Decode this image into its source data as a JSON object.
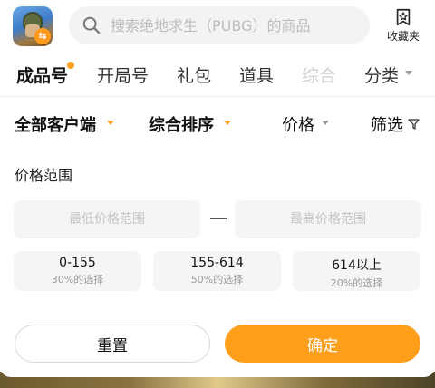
{
  "header": {
    "app_badge": "⇆",
    "search_placeholder": "搜索绝地求生（PUBG）的商品",
    "favorites_label": "收藏夹"
  },
  "tabs": [
    {
      "label": "成品号",
      "active": true
    },
    {
      "label": "开局号",
      "active": false
    },
    {
      "label": "礼包",
      "active": false
    },
    {
      "label": "道具",
      "active": false
    },
    {
      "label": "综合",
      "active": false
    },
    {
      "label": "分类",
      "active": false
    }
  ],
  "filters": {
    "client": "全部客户端",
    "sort": "综合排序",
    "price": "价格",
    "screen": "筛选"
  },
  "price_range": {
    "title": "价格范围",
    "min_placeholder": "最低价格范围",
    "max_placeholder": "最高价格范围",
    "options": [
      {
        "range": "0-155",
        "share": "30%的选择"
      },
      {
        "range": "155-614",
        "share": "50%的选择"
      },
      {
        "range": "614以上",
        "share": "20%的选择"
      }
    ]
  },
  "actions": {
    "reset": "重置",
    "confirm": "确定"
  },
  "colors": {
    "accent": "#ff9f1c",
    "input_bg": "#f5f5f5"
  }
}
